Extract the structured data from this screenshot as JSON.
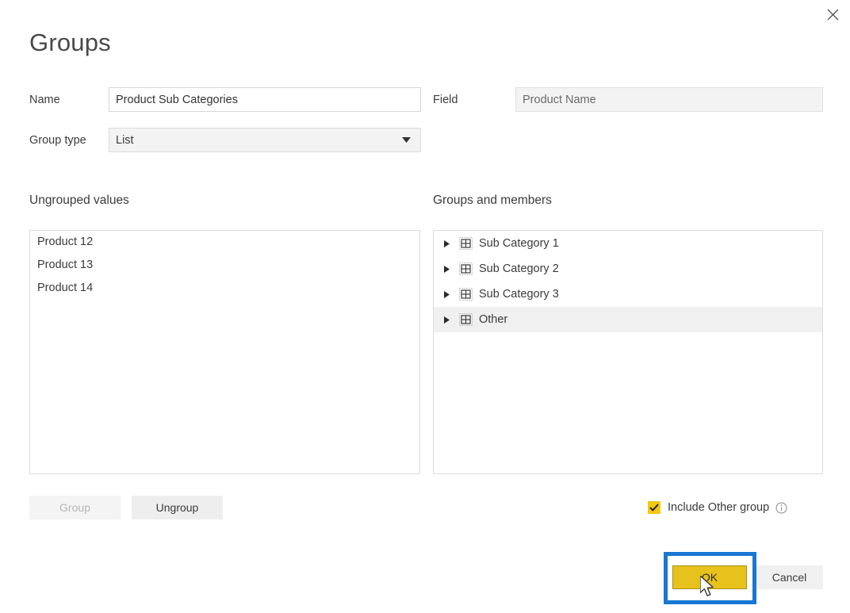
{
  "dialog": {
    "title": "Groups",
    "close_icon": "close-icon"
  },
  "form": {
    "name_label": "Name",
    "name_value": "Product Sub Categories",
    "group_type_label": "Group type",
    "group_type_value": "List",
    "group_type_caret_icon": "chevron-down-icon",
    "field_label": "Field",
    "field_value": "Product Name"
  },
  "ungrouped": {
    "heading": "Ungrouped values",
    "items": [
      {
        "label": "Product 12"
      },
      {
        "label": "Product 13"
      },
      {
        "label": "Product 14"
      }
    ]
  },
  "groups": {
    "heading": "Groups and members",
    "expand_icon": "triangle-right-icon",
    "group_icon": "table-grid-icon",
    "items": [
      {
        "label": "Sub Category 1",
        "selected": false
      },
      {
        "label": "Sub Category 2",
        "selected": false
      },
      {
        "label": "Sub Category 3",
        "selected": false
      },
      {
        "label": "Other",
        "selected": true
      }
    ]
  },
  "actions": {
    "group_label": "Group",
    "group_enabled": false,
    "ungroup_label": "Ungroup",
    "ungroup_enabled": true,
    "ok_label": "OK",
    "cancel_label": "Cancel"
  },
  "include_other": {
    "label": "Include Other group",
    "checked": true,
    "check_icon": "checkmark-icon",
    "info_icon": "info-circle-icon"
  },
  "annotation": {
    "highlight_color": "#1877d2",
    "ok_button_color": "#e8c21c",
    "checkbox_color": "#f2c811",
    "cursor_icon": "mouse-pointer-icon"
  }
}
